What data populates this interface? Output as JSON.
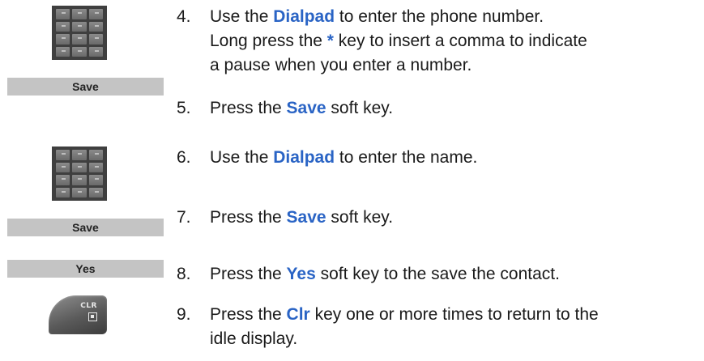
{
  "steps": [
    {
      "number": "4.",
      "line1_pre": "Use the ",
      "line1_kw": "Dialpad",
      "line1_post": " to enter the phone number.",
      "line2_pre": "Long press the ",
      "line2_symbol": "*",
      "line2_post": " key to insert a comma to indicate",
      "line3": "a pause when you enter a number.",
      "icon": "dialpad-icon"
    },
    {
      "number": "5.",
      "pre": "Press the ",
      "kw": "Save",
      "post": " soft key.",
      "softkey_label": "Save"
    },
    {
      "number": "6.",
      "pre": "Use the ",
      "kw": "Dialpad",
      "post": " to enter the name.",
      "icon": "dialpad-icon"
    },
    {
      "number": "7.",
      "pre": "Press the ",
      "kw": "Save",
      "post": " soft key.",
      "softkey_label": "Save"
    },
    {
      "number": "8.",
      "pre": "Press the ",
      "kw": "Yes",
      "post": " soft key to the save the contact.",
      "softkey_label": "Yes"
    },
    {
      "number": "9.",
      "pre": "Press the ",
      "kw": "Clr",
      "post": " key one or more times to return to the",
      "line2": "idle display.",
      "key_label": "CLR",
      "icon": "clr-key-icon"
    }
  ],
  "colors": {
    "keyword": "#2a64c5",
    "softkey_bg": "#c4c4c4"
  }
}
